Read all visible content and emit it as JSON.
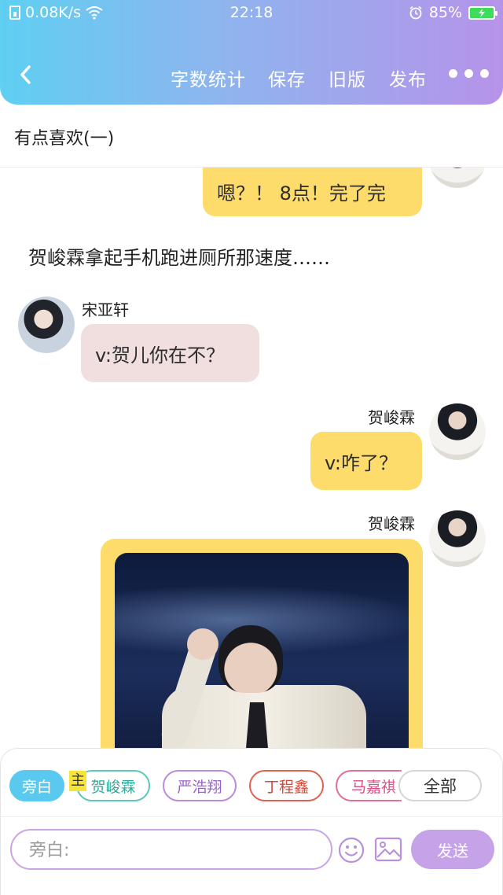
{
  "status_bar": {
    "net_speed": "0.08K/s",
    "time": "22:18",
    "battery": "85%"
  },
  "toolbar": {
    "word_count": "字数统计",
    "save": "保存",
    "old_version": "旧版",
    "publish": "发布"
  },
  "document": {
    "title": "有点喜欢(一)"
  },
  "messages": [
    {
      "side": "right",
      "text": "嗯？！ 8点！完了完"
    },
    {
      "type": "narration",
      "text": "贺峻霖拿起手机跑进厕所那速度……"
    },
    {
      "side": "left",
      "sender": "宋亚轩",
      "text": "v:贺儿你在不？"
    },
    {
      "side": "right",
      "sender": "贺峻霖",
      "text": "v:咋了？"
    },
    {
      "side": "right",
      "sender": "贺峻霖",
      "type": "image"
    }
  ],
  "characters": {
    "tag_main": "主",
    "chips": [
      "旁白",
      "贺峻霖",
      "严浩翔",
      "丁程鑫",
      "马嘉祺",
      "全部"
    ]
  },
  "composer": {
    "placeholder": "旁白:",
    "send": "发送"
  },
  "colors": {
    "header_start": "#5fcff2",
    "header_end": "#b693ea",
    "bubble_right": "#fedc6c",
    "bubble_left": "#f1dfdf",
    "send": "#c6a3e8",
    "chip_active": "#59c9ef"
  },
  "icons": [
    "sim-icon",
    "wifi-icon",
    "alarm-icon",
    "battery-icon",
    "back-icon",
    "more-icon",
    "emoji-icon",
    "image-icon"
  ]
}
